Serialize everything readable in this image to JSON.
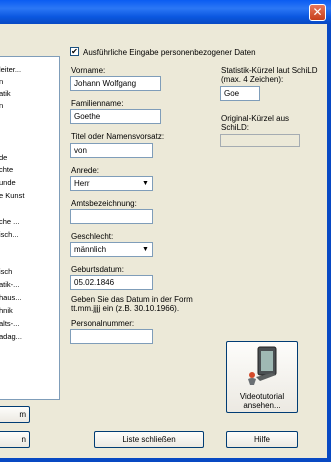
{
  "window": {
    "close_glyph": "✕"
  },
  "sidebar_list": [
    "leiter...",
    "n",
    "atik",
    "n",
    "",
    "",
    "",
    "de",
    "chte",
    "unde",
    "e Kunst",
    "",
    "che ...",
    "isch...",
    "",
    "",
    "isch",
    "atik-...",
    "haus...",
    "hnik",
    "alts-...",
    "adag..."
  ],
  "form": {
    "checkbox_label": "Ausführliche Eingabe personenbezogener Daten",
    "checkbox_checked": true,
    "vorname_label": "Vorname:",
    "vorname_value": "Johann Wolfgang",
    "familienname_label": "Familienname:",
    "familienname_value": "Goethe",
    "titel_label": "Titel oder Namensvorsatz:",
    "titel_value": "von",
    "anrede_label": "Anrede:",
    "anrede_value": "Herr",
    "amtsbezeichnung_label": "Amtsbezeichnung:",
    "amtsbezeichnung_value": "",
    "geschlecht_label": "Geschlecht:",
    "geschlecht_value": "männlich",
    "geburtsdatum_label": "Geburtsdatum:",
    "geburtsdatum_value": "05.02.1846",
    "datum_hint_1": "Geben Sie das Datum in der Form",
    "datum_hint_2": "tt.mm.jjjj ein (z.B. 30.10.1966).",
    "personalnummer_label": "Personalnummer:",
    "personalnummer_value": ""
  },
  "kuerzel": {
    "statistik_label_1": "Statistik-Kürzel laut SchiLD",
    "statistik_label_2": "(max. 4 Zeichen):",
    "statistik_value": "Goe",
    "original_label_1": "Original-Kürzel aus",
    "original_label_2": "SchiLD:",
    "original_value": ""
  },
  "buttons": {
    "left_top_label": "m",
    "left_bottom_label": "n",
    "liste_schliessen": "Liste schließen",
    "hilfe": "Hilfe",
    "videotutorial_1": "Videotutorial",
    "videotutorial_2": "ansehen..."
  },
  "colors": {
    "title_blue": "#0a5cf2",
    "panel_bg": "#ece9d8",
    "button_border": "#003c74"
  }
}
